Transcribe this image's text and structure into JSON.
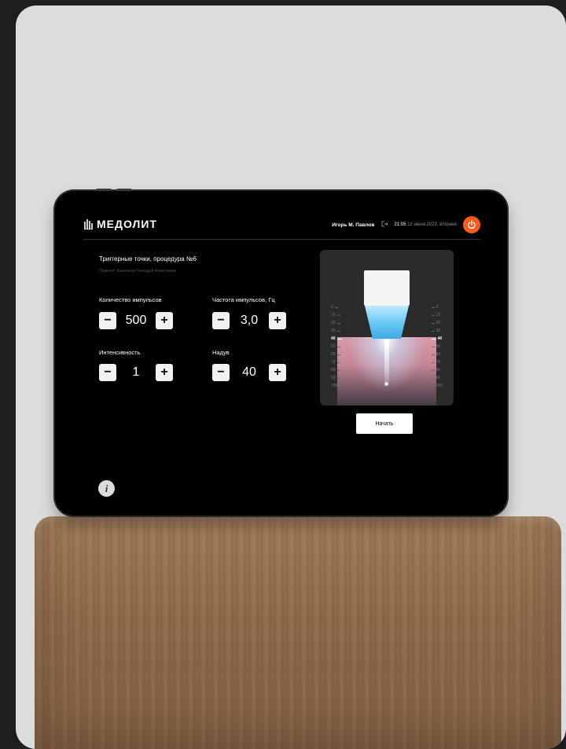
{
  "brand": {
    "name": "МЕДОЛИТ"
  },
  "header": {
    "user_name": "Игорь М. Павлов",
    "logout_icon": "logout-icon",
    "time": "21:05",
    "date": "12 июня 2022, вторник",
    "power_icon": "power-icon",
    "power_color": "#ff5a1f"
  },
  "procedure": {
    "title": "Триггерные точки, процедура №6",
    "patient": "Пациент: Ковальчук Геннадий Алексеевич"
  },
  "params": {
    "impulses": {
      "label": "Количество импульсов",
      "value": "500"
    },
    "frequency": {
      "label": "Частота импульсов, Гц",
      "value": "3,0"
    },
    "intensity": {
      "label": "Интенсивность",
      "value": "1"
    },
    "airflow": {
      "label": "Надув",
      "value": "40"
    }
  },
  "depth_scale": {
    "ticks": [
      "0",
      "10",
      "20",
      "30",
      "40",
      "50",
      "60",
      "70",
      "80",
      "90",
      "100"
    ],
    "selected": "40"
  },
  "actions": {
    "start_label": "Начать",
    "info_icon": "info-icon"
  }
}
